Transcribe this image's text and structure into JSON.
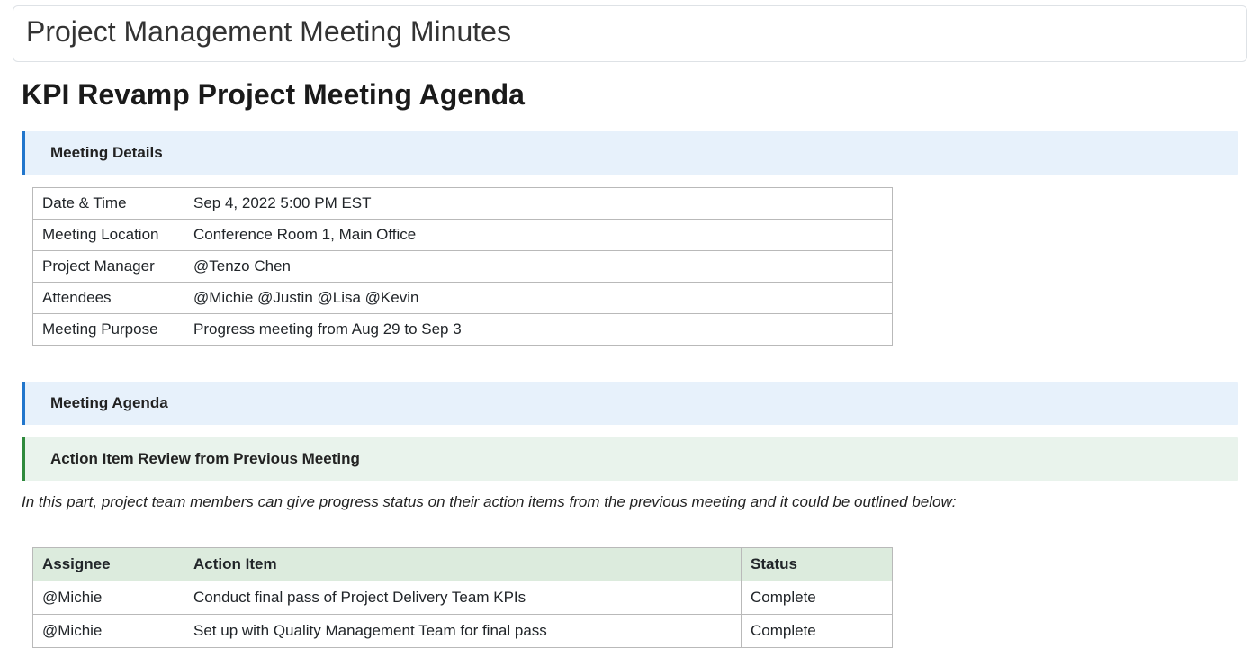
{
  "title_card": "Project Management Meeting Minutes",
  "page_heading": "KPI Revamp Project Meeting Agenda",
  "sections": {
    "meeting_details_label": "Meeting Details",
    "meeting_agenda_label": "Meeting Agenda",
    "action_review_label": "Action Item Review from Previous Meeting"
  },
  "details": {
    "date_time_label": "Date & Time",
    "date_time_value": "Sep 4, 2022 5:00 PM EST",
    "location_label": "Meeting Location",
    "location_value": "Conference Room 1, Main Office",
    "pm_label": "Project Manager",
    "pm_value": "@Tenzo Chen",
    "attendees_label": "Attendees",
    "attendees_value": "@Michie @Justin @Lisa @Kevin",
    "purpose_label": "Meeting Purpose",
    "purpose_value": "Progress meeting from Aug 29 to Sep 3"
  },
  "action_review_note": "In this part, project team members can give progress status on their action items from the previous meeting and it could be outlined below:",
  "action_table": {
    "headers": {
      "assignee": "Assignee",
      "action_item": "Action Item",
      "status": "Status"
    },
    "rows": [
      {
        "assignee": "@Michie",
        "action_item": "Conduct final pass of Project Delivery Team KPIs",
        "status": "Complete"
      },
      {
        "assignee": "@Michie",
        "action_item": "Set up with Quality Management Team for final pass",
        "status": "Complete"
      }
    ]
  }
}
